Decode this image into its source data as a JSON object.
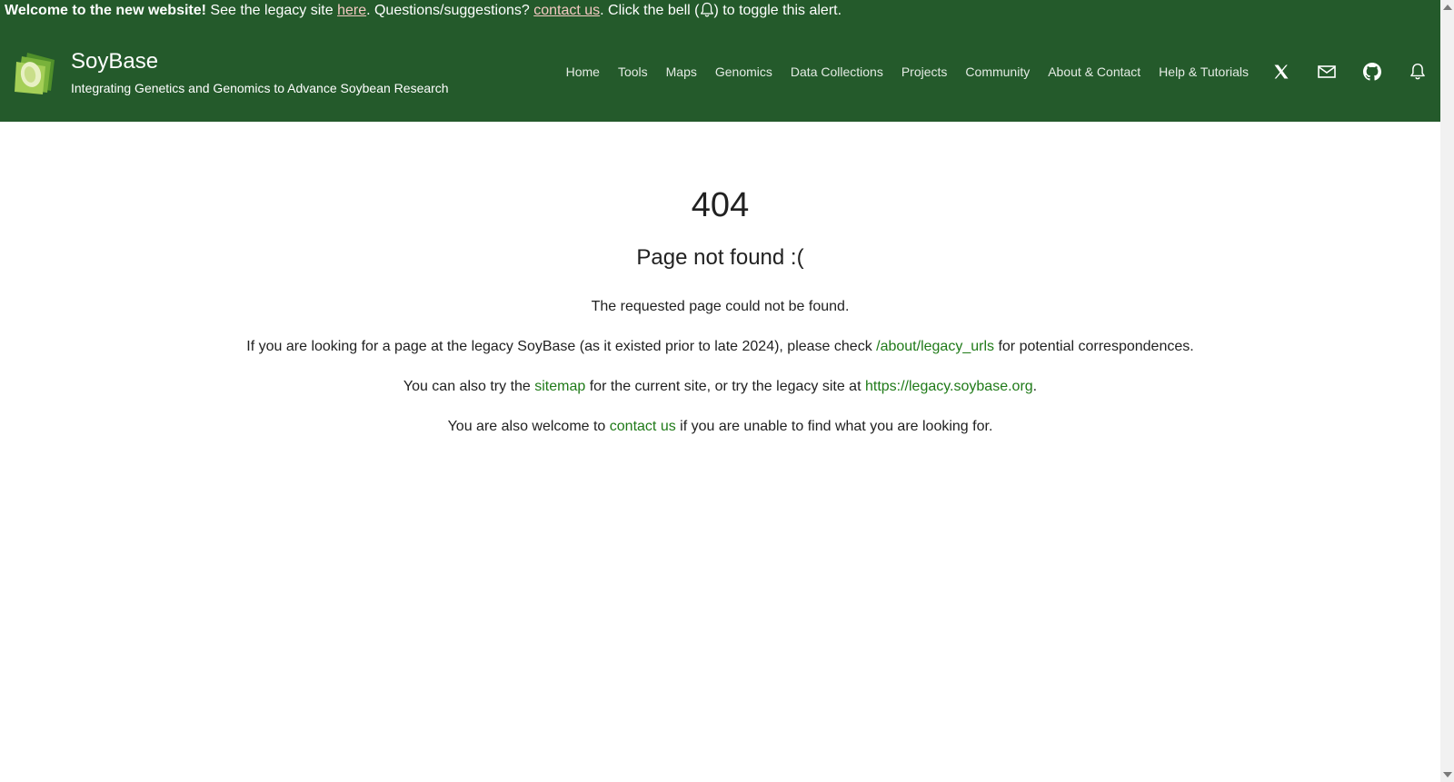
{
  "colors": {
    "header_bg": "#245a2b",
    "link_green": "#1f7a18",
    "alert_link": "#f3c9c2",
    "text": "#212121"
  },
  "alert": {
    "bold": "Welcome to the new website!",
    "text1": " See the legacy site ",
    "link_here": "here",
    "text2": ". Questions/suggestions? ",
    "link_contact": "contact us",
    "text3": ". Click the bell (",
    "bell_icon": "bell-icon",
    "text4": ") to toggle this alert."
  },
  "brand": {
    "title": "SoyBase",
    "subtitle": "Integrating Genetics and Genomics to Advance Soybean Research",
    "logo_icon": "soybean-logo"
  },
  "nav": {
    "items": [
      "Home",
      "Tools",
      "Maps",
      "Genomics",
      "Data Collections",
      "Projects",
      "Community",
      "About & Contact",
      "Help & Tutorials"
    ],
    "icons": [
      "x-twitter-icon",
      "mail-icon",
      "github-icon",
      "bell-icon"
    ]
  },
  "error": {
    "code": "404",
    "title": "Page not found :(",
    "line1": "The requested page could not be found.",
    "line2_pre": "If you are looking for a page at the legacy SoyBase (as it existed prior to late 2024), please check ",
    "line2_link": "/about/legacy_urls",
    "line2_post": " for potential correspondences.",
    "line3_pre": "You can also try the ",
    "line3_link1": "sitemap",
    "line3_mid": " for the current site, or try the legacy site at ",
    "line3_link2": "https://legacy.soybase.org",
    "line3_post": ".",
    "line4_pre": "You are also welcome to ",
    "line4_link": "contact us",
    "line4_post": " if you are unable to find what you are looking for."
  }
}
